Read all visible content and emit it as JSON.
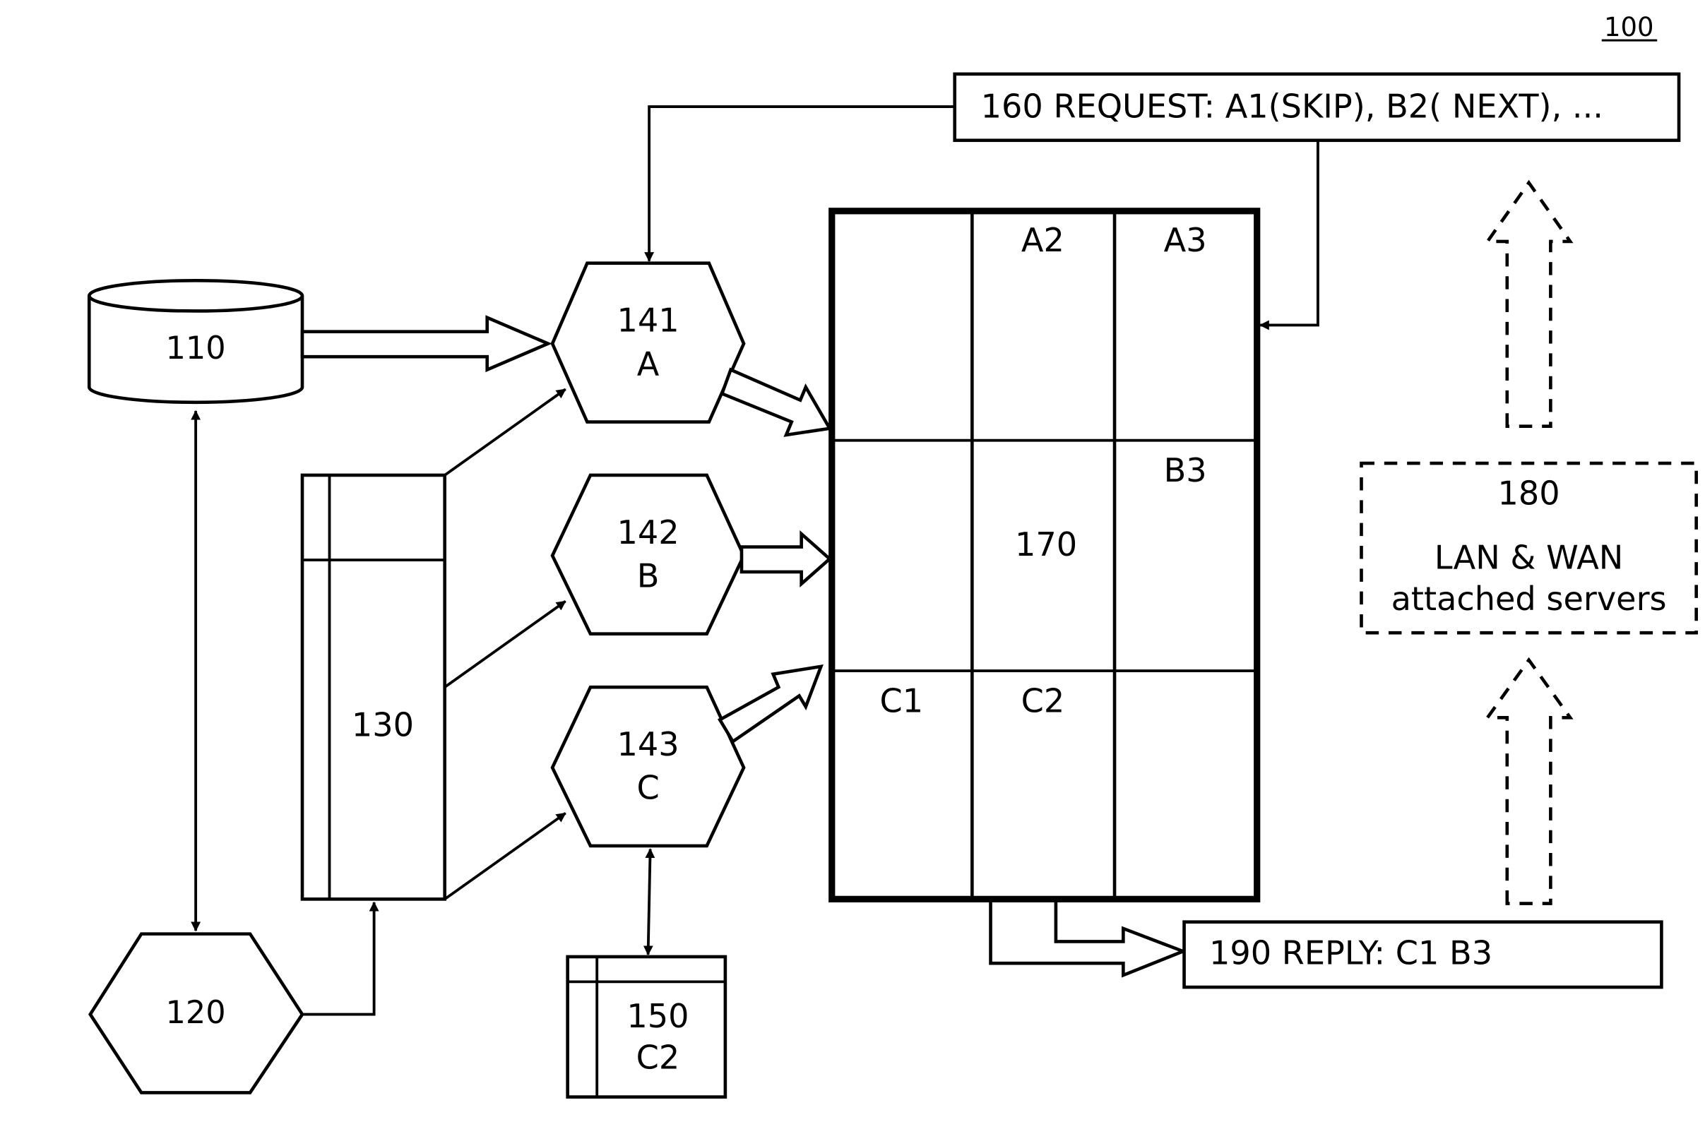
{
  "figure": {
    "reference_number": "100",
    "colors": {
      "stroke": "#000000",
      "background": "#ffffff"
    }
  },
  "nodes": {
    "database": {
      "label": "110",
      "shape": "cylinder"
    },
    "hexagon_120": {
      "label": "120",
      "shape": "hexagon"
    },
    "table_130": {
      "label": "130",
      "shape": "table"
    },
    "hex_141": {
      "line1": "141",
      "line2": "A",
      "shape": "hexagon"
    },
    "hex_142": {
      "line1": "142",
      "line2": "B",
      "shape": "hexagon"
    },
    "hex_143": {
      "line1": "143",
      "line2": "C",
      "shape": "hexagon"
    },
    "table_150": {
      "line1": "150",
      "line2": "C2",
      "shape": "table"
    },
    "request_160": {
      "label": "160 REQUEST: A1(SKIP), B2( NEXT), ..."
    },
    "grid_170": {
      "label": "170",
      "cells": [
        [
          "",
          "A2",
          "A3"
        ],
        [
          "",
          "",
          "B3"
        ],
        [
          "C1",
          "C2",
          ""
        ]
      ]
    },
    "servers_180": {
      "line1": "180",
      "line2": "LAN & WAN",
      "line3": "attached servers"
    },
    "reply_190": {
      "label": "190 REPLY:   C1 B3"
    }
  }
}
